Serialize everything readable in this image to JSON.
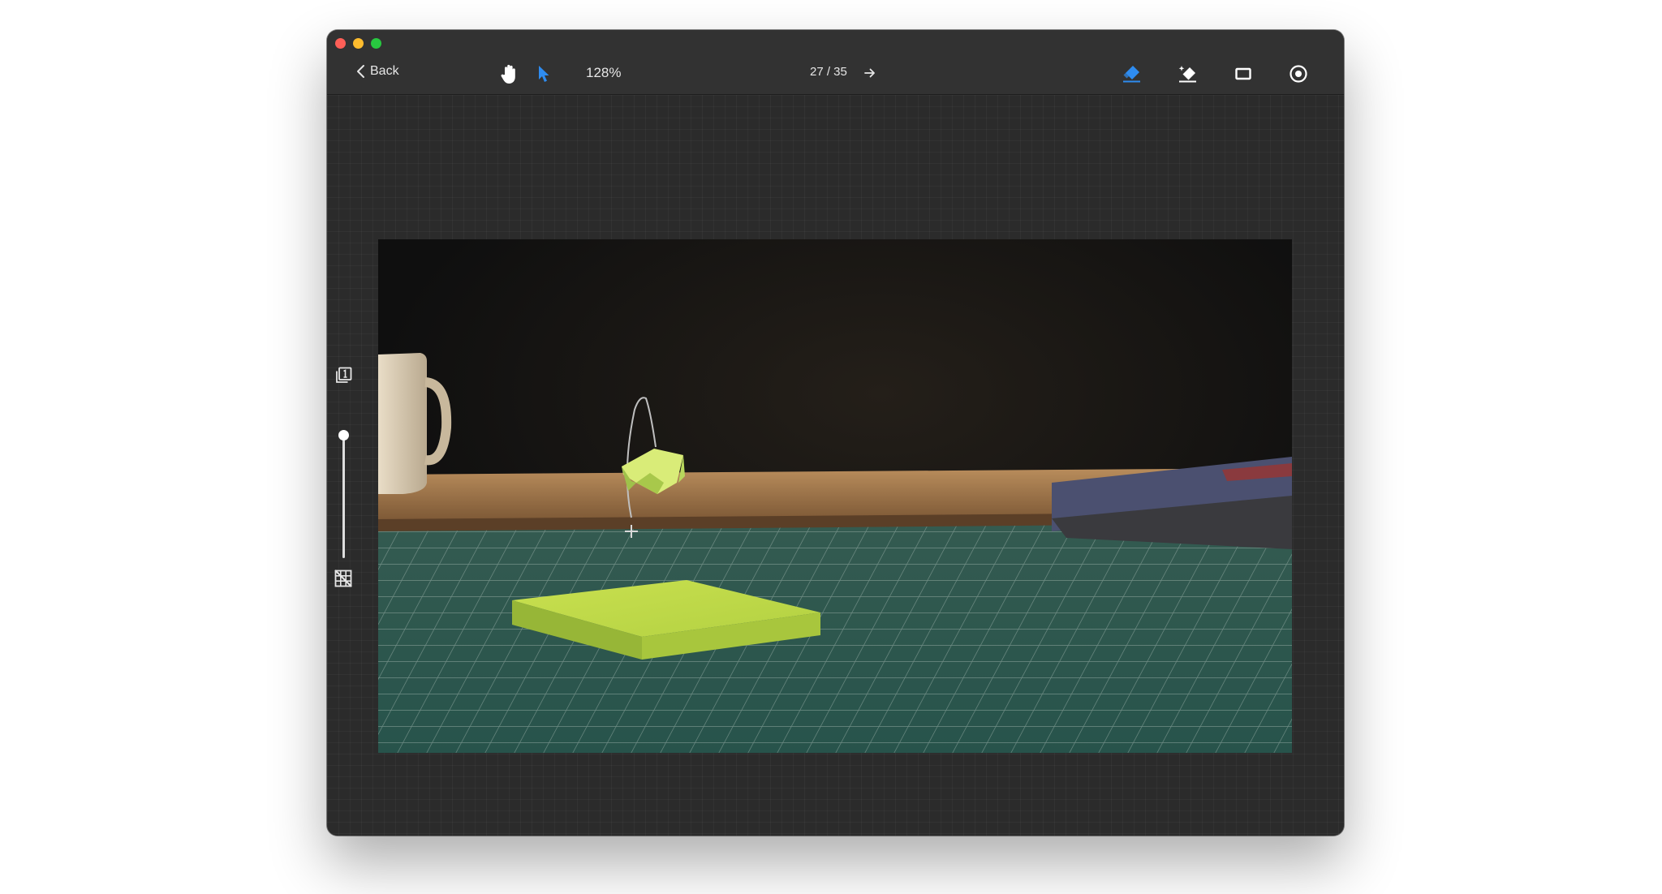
{
  "window": {
    "traffic_lights": [
      "close",
      "minimize",
      "maximize"
    ]
  },
  "toolbar": {
    "back_label": "Back",
    "zoom_label": "128%",
    "page_indicator": "27 / 35",
    "tools": {
      "hand": "hand-icon",
      "pointer": "pointer-icon",
      "next": "arrow-right-icon",
      "eraser": "eraser-icon",
      "magic_eraser": "magic-eraser-icon",
      "rectangle": "rectangle-icon",
      "record": "record-icon"
    }
  },
  "side_panel": {
    "top_icon": "single-layer-icon",
    "bottom_icon": "grid-off-icon",
    "slider_value": 1.0
  },
  "colors": {
    "accent": "#2e8cf0",
    "toolbar_bg": "#323232",
    "canvas_bg": "#2b2b2b",
    "close": "#fe5f57",
    "minimize": "#febc2e",
    "maximize": "#28c840"
  }
}
